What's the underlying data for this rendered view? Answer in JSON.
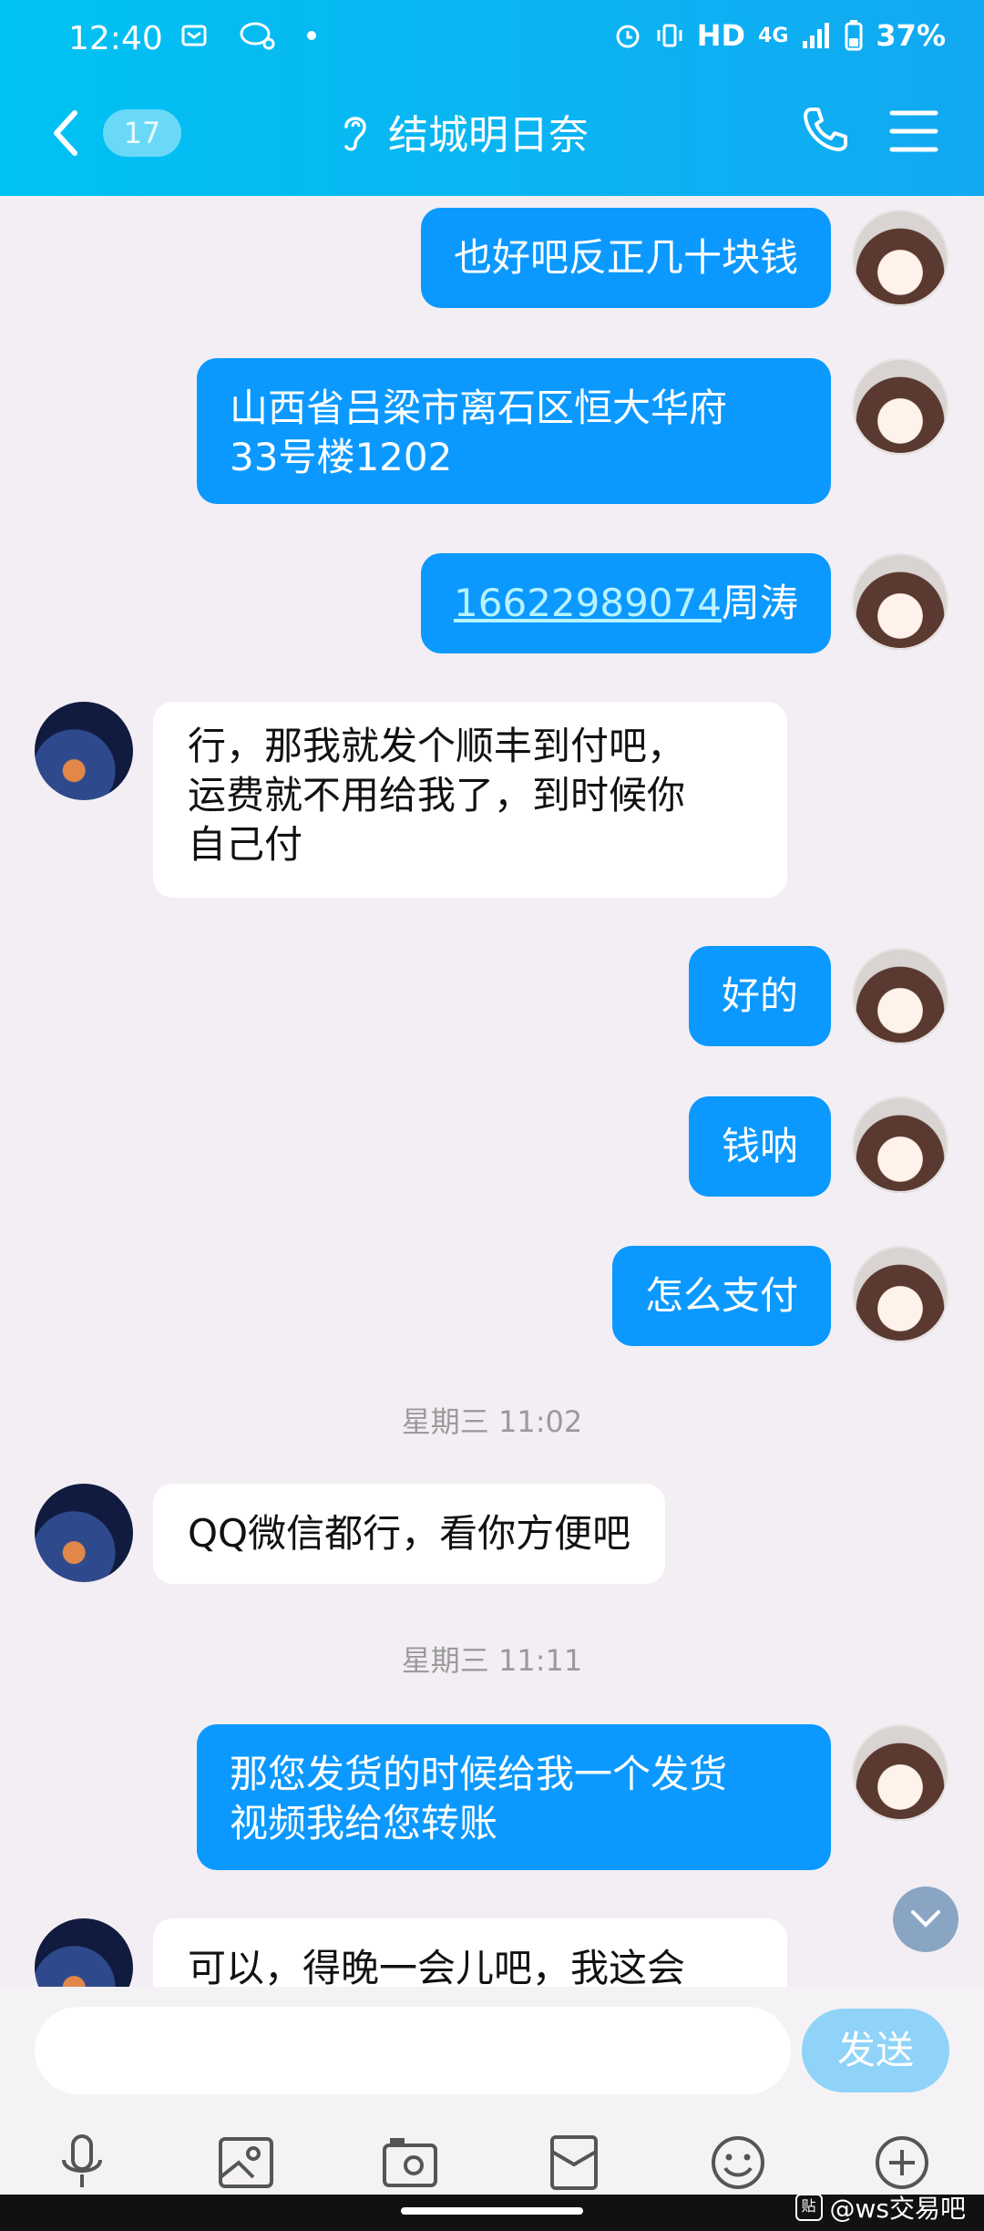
{
  "status_bar": {
    "time": "12:40",
    "network": "HD",
    "signal_label": "4G",
    "battery": "37%"
  },
  "header": {
    "unread_count": "17",
    "contact_name": "结城明日奈"
  },
  "messages": [
    {
      "side": "me",
      "text": "也好吧反正几十块钱"
    },
    {
      "side": "me",
      "text_lines": [
        "山西省吕梁市离石区恒大华府",
        "33号楼1202"
      ]
    },
    {
      "side": "me",
      "link": "16622989074",
      "text": "周涛"
    },
    {
      "side": "them",
      "text_lines": [
        "行，那我就发个顺丰到付吧，",
        "运费就不用给我了，到时候你",
        "自己付"
      ]
    },
    {
      "side": "me",
      "text": "好的"
    },
    {
      "side": "me",
      "text": "钱呐"
    },
    {
      "side": "me",
      "text": "怎么支付"
    },
    {
      "side": "time",
      "text": "星期三 11:02"
    },
    {
      "side": "them",
      "text": "QQ微信都行，看你方便吧"
    },
    {
      "side": "time",
      "text": "星期三 11:11"
    },
    {
      "side": "me",
      "text_lines": [
        "那您发货的时候给我一个发货",
        "视频我给您转账"
      ]
    },
    {
      "side": "them",
      "text": "可以，得晚一会儿吧，我这会"
    }
  ],
  "input": {
    "placeholder": "",
    "send_label": "发送"
  },
  "toolbar_icons": [
    "mic-icon",
    "image-icon",
    "camera-icon",
    "red-packet-icon",
    "emoji-icon",
    "plus-icon"
  ],
  "watermark": "@ws交易吧",
  "colors": {
    "header_start": "#00c2f2",
    "my_bubble": "#0b99ff",
    "their_bubble": "#ffffff",
    "background": "#f3eef3"
  }
}
